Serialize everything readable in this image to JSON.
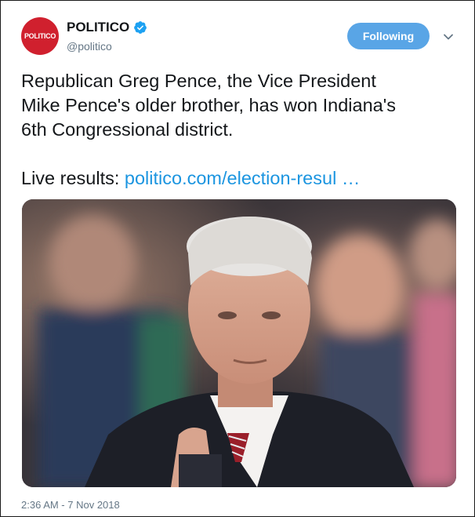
{
  "account": {
    "avatar_text": "POLITICO",
    "display_name": "POLITICO",
    "handle": "@politico",
    "verified": true
  },
  "follow_button": {
    "label": "Following"
  },
  "tweet": {
    "line1": "Republican Greg Pence, the Vice President",
    "line2": "Mike Pence's older brother, has won Indiana's",
    "line3": "6th Congressional district.",
    "live_prefix": "Live results:",
    "link_text": "politico.com/election-resul …"
  },
  "timestamp": "2:36 AM - 7 Nov 2018",
  "colors": {
    "brand_red": "#d0202e",
    "link_blue": "#1b95e0",
    "button_blue": "#59a5e6",
    "muted": "#657786"
  },
  "icons": {
    "verified": "verified-badge-icon",
    "chevron": "chevron-down-icon"
  }
}
